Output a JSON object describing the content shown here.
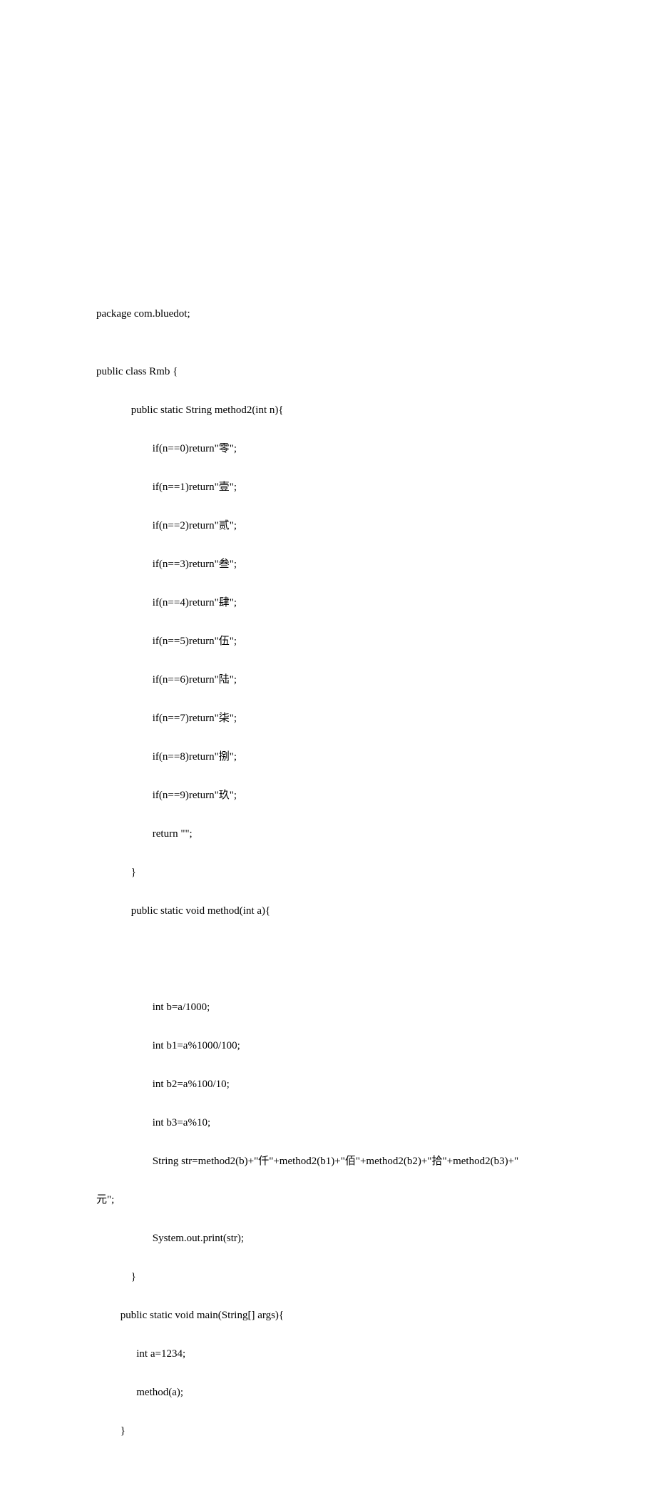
{
  "code": {
    "lines": [
      "package com.bluedot;",
      "",
      "public class Rmb {",
      "             public static String method2(int n){",
      "                     if(n==0)return\"零\";",
      "                     if(n==1)return\"壹\";",
      "                     if(n==2)return\"贰\";",
      "                     if(n==3)return\"叁\";",
      "                     if(n==4)return\"肆\";",
      "                     if(n==5)return\"伍\";",
      "                     if(n==6)return\"陆\";",
      "                     if(n==7)return\"柒\";",
      "                     if(n==8)return\"捌\";",
      "                     if(n==9)return\"玖\";",
      "                     return \"\";",
      "             }",
      "             public static void method(int a){",
      "                     ",
      "",
      "                     int b=a/1000;",
      "                     int b1=a%1000/100;",
      "                     int b2=a%100/10;",
      "                     int b3=a%10;",
      "                     String str=method2(b)+\"仟\"+method2(b1)+\"佰\"+method2(b2)+\"拾\"+method2(b3)+\"",
      "元\";",
      "                     System.out.print(str);",
      "             }",
      "         public static void main(String[] args){",
      "               int a=1234;",
      "               method(a);",
      "         }"
    ]
  }
}
